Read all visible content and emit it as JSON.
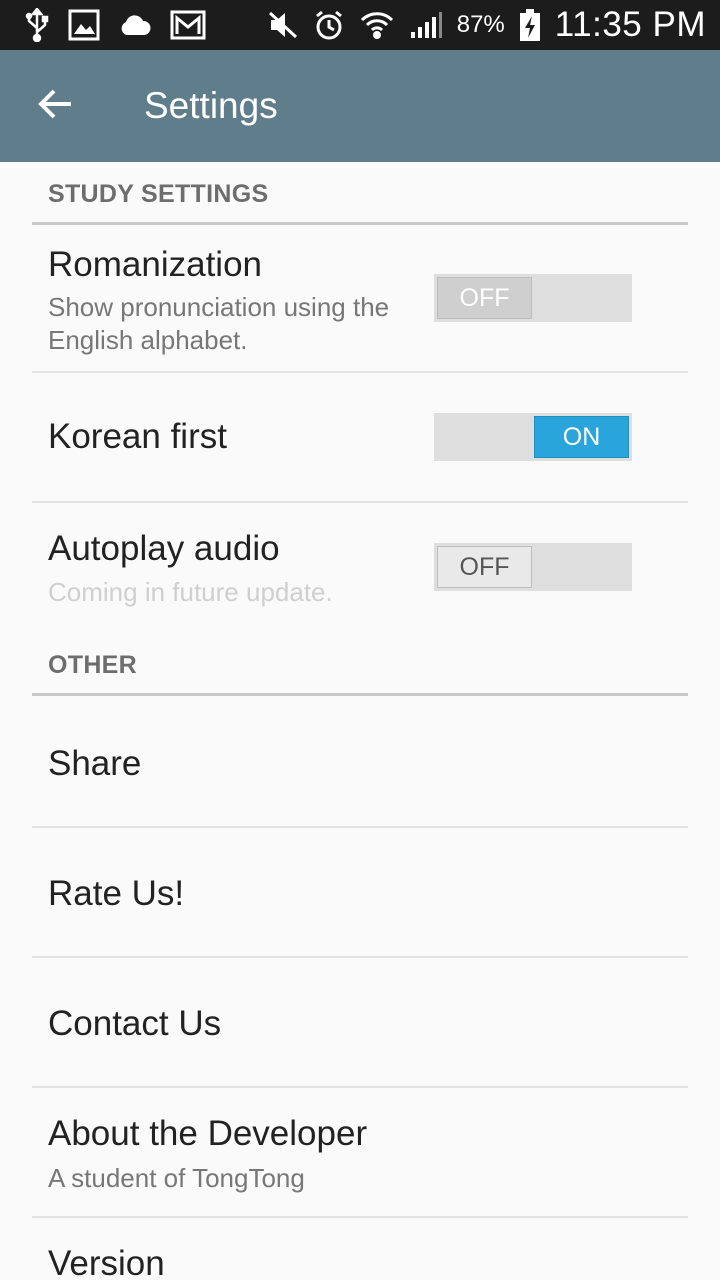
{
  "status_bar": {
    "left_icons": [
      "usb-icon",
      "image-icon",
      "cloud-icon",
      "gmail-icon"
    ],
    "right_icons": [
      "mute-icon",
      "alarm-icon",
      "wifi-icon",
      "signal-icon",
      "battery-icon"
    ],
    "battery_percent": "87%",
    "time": "11:35 PM"
  },
  "app_bar": {
    "title": "Settings",
    "back_icon": "arrow-left-icon",
    "color": "#607d8b"
  },
  "sections": {
    "study": {
      "header": "STUDY SETTINGS",
      "romanization": {
        "title": "Romanization",
        "summary": "Show pronunciation using the English alphabet.",
        "toggle_label": "OFF"
      },
      "korean_first": {
        "title": "Korean first",
        "toggle_label": "ON"
      },
      "autoplay": {
        "title": "Autoplay audio",
        "summary": "Coming in future update.",
        "toggle_label": "OFF"
      }
    },
    "other": {
      "header": "OTHER",
      "share": {
        "title": "Share"
      },
      "rate": {
        "title": "Rate Us!"
      },
      "contact": {
        "title": "Contact Us"
      },
      "about": {
        "title": "About the Developer",
        "summary": "A student of TongTong"
      },
      "version": {
        "title": "Version"
      }
    }
  },
  "colors": {
    "toggle_on": "#2aa5dc",
    "background": "#fafafa"
  }
}
